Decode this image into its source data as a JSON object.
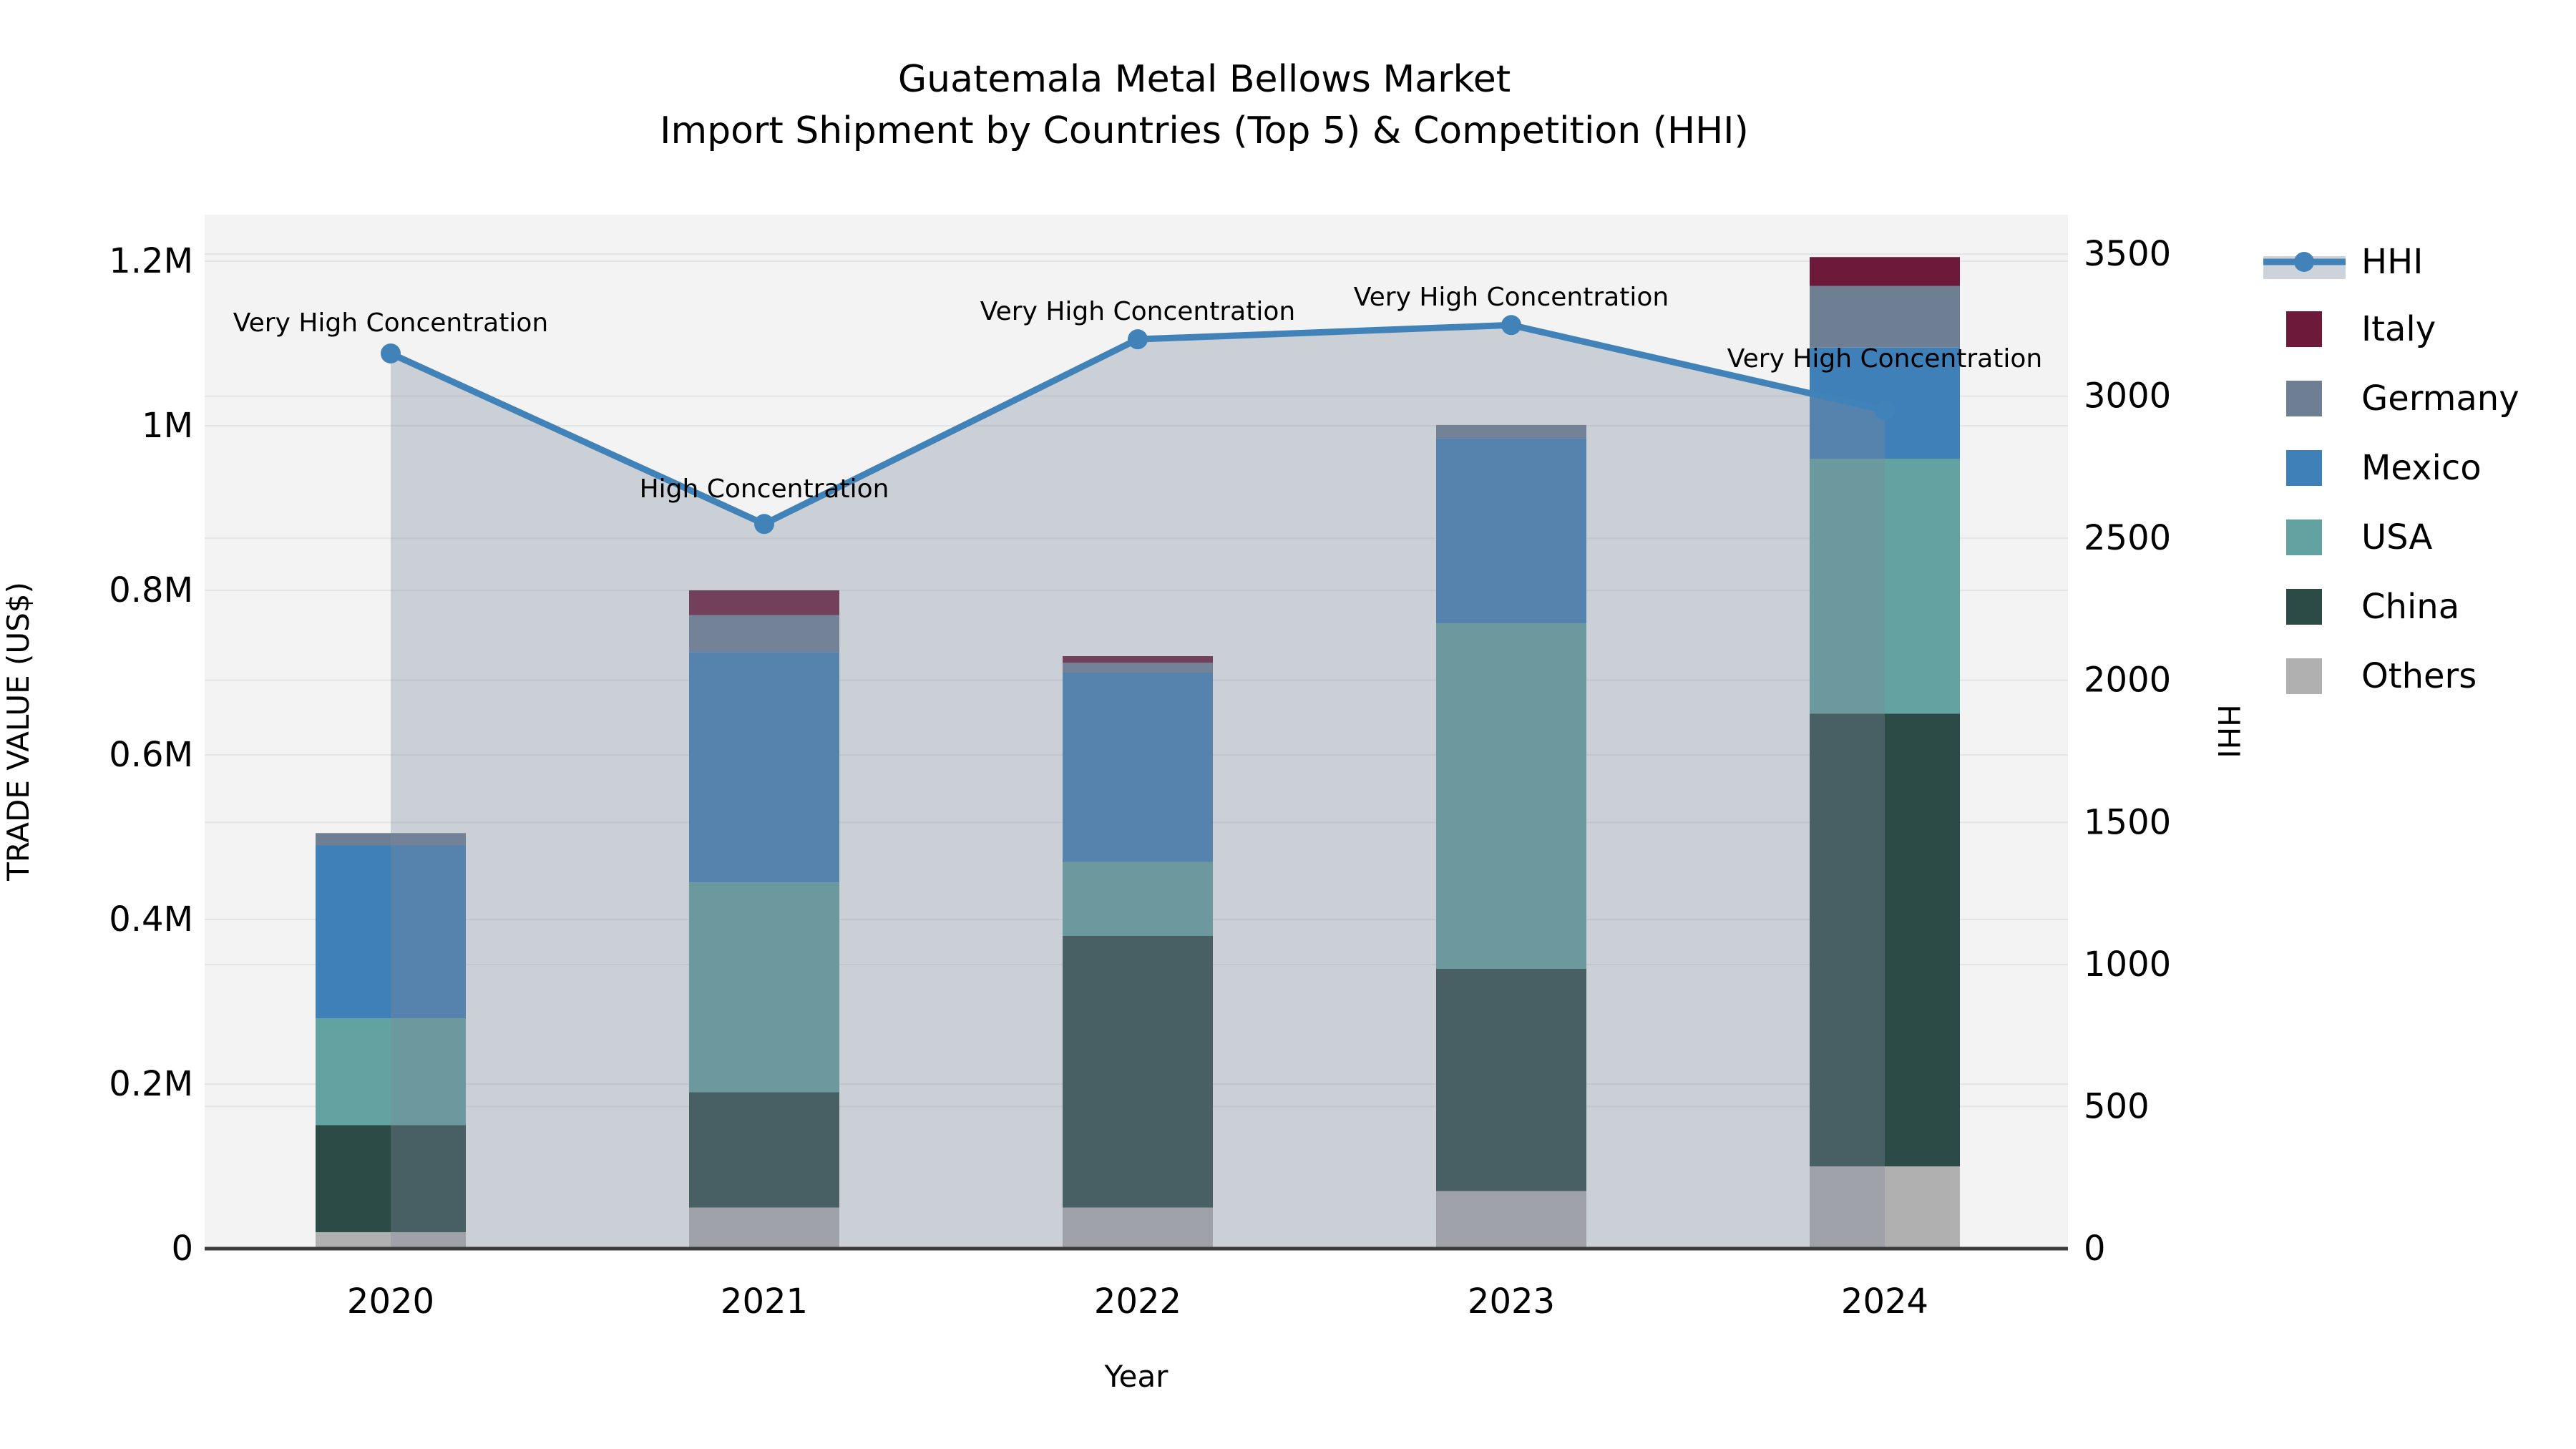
{
  "title": {
    "line1": "Guatemala Metal Bellows Market",
    "line2": "Import Shipment by Countries (Top 5) & Competition (HHI)"
  },
  "axis_titles": {
    "left": "TRADE VALUE (US$)",
    "right": "HHI",
    "bottom": "Year"
  },
  "colors": {
    "plot_bg": "#f3f3f4",
    "grid": "#e4e5e7",
    "axis_line": "#3b3b3b",
    "hhi_line": "#4183b8",
    "hhi_fill": "rgba(126,138,155,0.34)",
    "legend_band": "#cdd3da",
    "series": {
      "Italy": "#6d1a3a",
      "Germany": "#6e7f93",
      "Mexico": "#4080b8",
      "USA": "#62a2a0",
      "China": "#2d4b46",
      "Others": "#b0b0b0"
    }
  },
  "legend": {
    "items": [
      {
        "label": "HHI",
        "type": "line"
      },
      {
        "label": "Italy",
        "type": "swatch"
      },
      {
        "label": "Germany",
        "type": "swatch"
      },
      {
        "label": "Mexico",
        "type": "swatch"
      },
      {
        "label": "USA",
        "type": "swatch"
      },
      {
        "label": "China",
        "type": "swatch"
      },
      {
        "label": "Others",
        "type": "swatch"
      }
    ]
  },
  "chart_data": {
    "type": "bar+line",
    "title": "Guatemala Metal Bellows Market — Import Shipment by Countries (Top 5) & Competition (HHI)",
    "xlabel": "Year",
    "ylabel_left": "TRADE VALUE (US$)",
    "ylabel_right": "HHI",
    "categories": [
      "2020",
      "2021",
      "2022",
      "2023",
      "2024"
    ],
    "stack_order_bottom_to_top": [
      "Others",
      "China",
      "USA",
      "Mexico",
      "Germany",
      "Italy"
    ],
    "series": [
      {
        "name": "Others",
        "values": [
          20000,
          50000,
          50000,
          70000,
          100000
        ]
      },
      {
        "name": "China",
        "values": [
          130000,
          140000,
          330000,
          270000,
          550000
        ]
      },
      {
        "name": "USA",
        "values": [
          130000,
          255000,
          90000,
          420000,
          310000
        ]
      },
      {
        "name": "Mexico",
        "values": [
          210000,
          280000,
          230000,
          225000,
          135000
        ]
      },
      {
        "name": "Germany",
        "values": [
          15000,
          45000,
          12000,
          16000,
          75000
        ]
      },
      {
        "name": "Italy",
        "values": [
          0,
          30000,
          8000,
          0,
          35000
        ]
      }
    ],
    "bar_totals": [
      505000,
      800000,
      720000,
      1001000,
      1205000
    ],
    "line_series": {
      "name": "HHI",
      "axis": "right",
      "values": [
        3150,
        2550,
        3200,
        3250,
        2950
      ],
      "area_fill": true
    },
    "annotations": [
      "Very High Concentration",
      "High Concentration",
      "Very High Concentration",
      "Very High Concentration",
      "Very High Concentration"
    ],
    "left_axis": {
      "range": [
        0,
        1260000
      ],
      "ticks": [
        {
          "label": "0",
          "value": 0
        },
        {
          "label": "0.2M",
          "value": 200000
        },
        {
          "label": "0.4M",
          "value": 400000
        },
        {
          "label": "0.6M",
          "value": 600000
        },
        {
          "label": "0.8M",
          "value": 800000
        },
        {
          "label": "1M",
          "value": 1000000
        },
        {
          "label": "1.2M",
          "value": 1200000
        }
      ]
    },
    "right_axis": {
      "range": [
        0,
        3500
      ],
      "ticks": [
        {
          "label": "0",
          "value": 0
        },
        {
          "label": "500",
          "value": 500
        },
        {
          "label": "1000",
          "value": 1000
        },
        {
          "label": "1500",
          "value": 1500
        },
        {
          "label": "2000",
          "value": 2000
        },
        {
          "label": "2500",
          "value": 2500
        },
        {
          "label": "3000",
          "value": 3000
        },
        {
          "label": "3500",
          "value": 3500
        }
      ]
    },
    "grid": true,
    "legend_position": "right"
  }
}
